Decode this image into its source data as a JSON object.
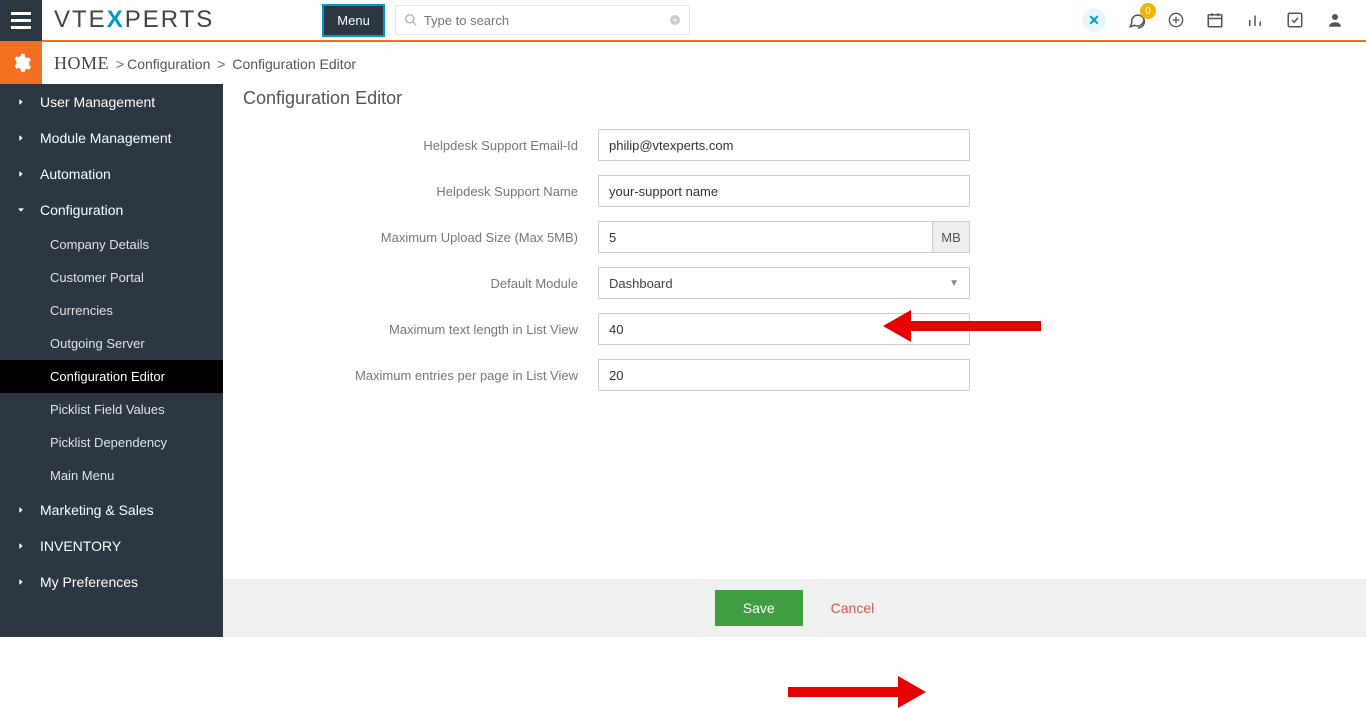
{
  "header": {
    "menu_label": "Menu",
    "search_placeholder": "Type to search",
    "notification_count": "0"
  },
  "breadcrumb": {
    "home": "HOME",
    "level1": "Configuration",
    "level2": "Configuration Editor"
  },
  "sidebar": {
    "items": [
      {
        "label": "User Management",
        "expanded": false
      },
      {
        "label": "Module Management",
        "expanded": false
      },
      {
        "label": "Automation",
        "expanded": false
      },
      {
        "label": "Configuration",
        "expanded": true
      },
      {
        "label": "Marketing & Sales",
        "expanded": false
      },
      {
        "label": "INVENTORY",
        "expanded": false
      },
      {
        "label": "My Preferences",
        "expanded": false
      }
    ],
    "config_children": [
      {
        "label": "Company Details"
      },
      {
        "label": "Customer Portal"
      },
      {
        "label": "Currencies"
      },
      {
        "label": "Outgoing Server"
      },
      {
        "label": "Configuration Editor"
      },
      {
        "label": "Picklist Field Values"
      },
      {
        "label": "Picklist Dependency"
      },
      {
        "label": "Main Menu"
      }
    ]
  },
  "page": {
    "title": "Configuration Editor"
  },
  "form": {
    "helpdesk_email_label": "Helpdesk Support Email-Id",
    "helpdesk_email_value": "philip@vtexperts.com",
    "helpdesk_name_label": "Helpdesk Support Name",
    "helpdesk_name_value": "your-support name",
    "max_upload_label": "Maximum Upload Size (Max 5MB)",
    "max_upload_value": "5",
    "max_upload_suffix": "MB",
    "default_module_label": "Default Module",
    "default_module_value": "Dashboard",
    "max_text_label": "Maximum text length in List View",
    "max_text_value": "40",
    "max_entries_label": "Maximum entries per page in List View",
    "max_entries_value": "20"
  },
  "footer": {
    "save_label": "Save",
    "cancel_label": "Cancel"
  }
}
